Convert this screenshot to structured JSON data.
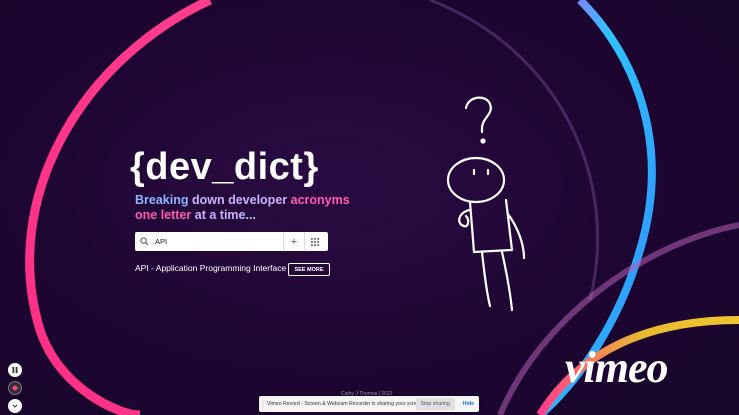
{
  "app": {
    "logo": "{dev_dict}",
    "tagline": {
      "word1": "Breaking",
      "word2": "down developer",
      "word3": "acronyms one",
      "word4": "letter",
      "word5": "at a time..."
    }
  },
  "search": {
    "value": "API",
    "placeholder": "",
    "icons": {
      "search": "search-icon",
      "add": "plus-icon",
      "grid": "grid-icon"
    }
  },
  "result": {
    "text": "API - Application Programming Interface",
    "button_label": "SEE MORE"
  },
  "watermark": {
    "text": "vimeo"
  },
  "footer": {
    "credit": "Cathy J Thomas | 2022"
  },
  "recorder": {
    "share_message": "Vimeo Record - Screen & Webcam Recorder is sharing your screen.",
    "stop_label": "Stop sharing",
    "hide_label": "Hide"
  },
  "colors": {
    "background": "#1e0731",
    "arc_pink": "#ff2f86",
    "arc_blue": "#2fc4ff",
    "arc_gold": "#e8b830",
    "tagline_blue": "#8fb7ff",
    "tagline_pink": "#ff5bb0"
  }
}
